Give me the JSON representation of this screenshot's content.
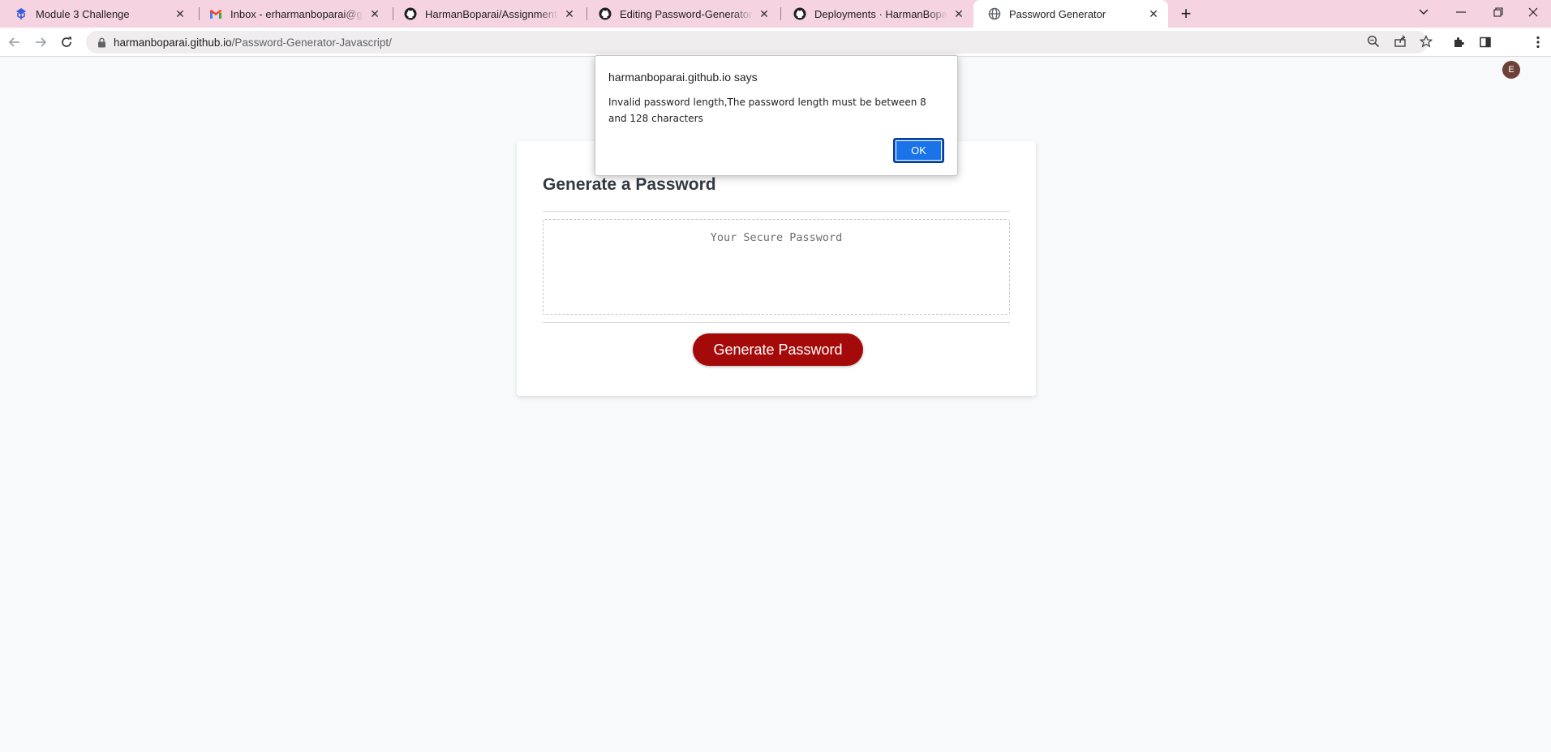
{
  "browser": {
    "tabs": [
      {
        "title": "Module 3 Challenge",
        "icon": "bootcamp-logo-icon",
        "active": false
      },
      {
        "title": "Inbox - erharmanboparai@gmail.com",
        "icon": "gmail-icon",
        "active": false
      },
      {
        "title": "HarmanBoparai/Assignment-Challenge",
        "icon": "github-icon",
        "active": false
      },
      {
        "title": "Editing Password-Generator-Javascript",
        "icon": "github-icon",
        "active": false
      },
      {
        "title": "Deployments · HarmanBoparai/Password",
        "icon": "github-icon",
        "active": false
      },
      {
        "title": "Password Generator",
        "icon": "globe-icon",
        "active": true
      }
    ],
    "url_host": "harmanboparai.github.io",
    "url_path": "/Password-Generator-Javascript/",
    "profile_initial": "E",
    "colors": {
      "tabstrip": "#f5d3e0",
      "omnibox": "#efeded",
      "avatar": "#6d4037"
    }
  },
  "page": {
    "title": "Generate a Password",
    "password_placeholder": "Your Secure Password",
    "generate_label": "Generate Password",
    "colors": {
      "button": "#a50a0a",
      "background": "#f7f9fb"
    }
  },
  "dialog": {
    "title": "harmanboparai.github.io says",
    "message": "Invalid password length,The password length must be between 8 and 128 characters",
    "ok_label": "OK",
    "colors": {
      "ok": "#1a73e8"
    }
  }
}
